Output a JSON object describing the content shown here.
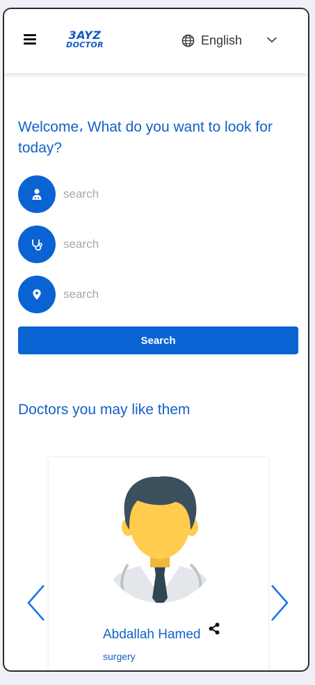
{
  "header": {
    "logo_line1": "3AYZ",
    "logo_line2": "DOCTOR",
    "language": "English"
  },
  "welcome": {
    "text": "Welcome، What do you want to look for today?"
  },
  "search": {
    "fields": [
      {
        "icon": "doctor-icon",
        "placeholder": "search",
        "value": ""
      },
      {
        "icon": "stethoscope-icon",
        "placeholder": "search",
        "value": ""
      },
      {
        "icon": "location-pin-icon",
        "placeholder": "search",
        "value": ""
      }
    ],
    "button_label": "Search"
  },
  "doctors": {
    "title": "Doctors you may like them",
    "cards": [
      {
        "name": "Abdallah Hamed",
        "specialty": "surgery"
      }
    ]
  },
  "colors": {
    "primary": "#0a63d2",
    "text_blue": "#1261c8",
    "arrow": "#1a73e8"
  }
}
